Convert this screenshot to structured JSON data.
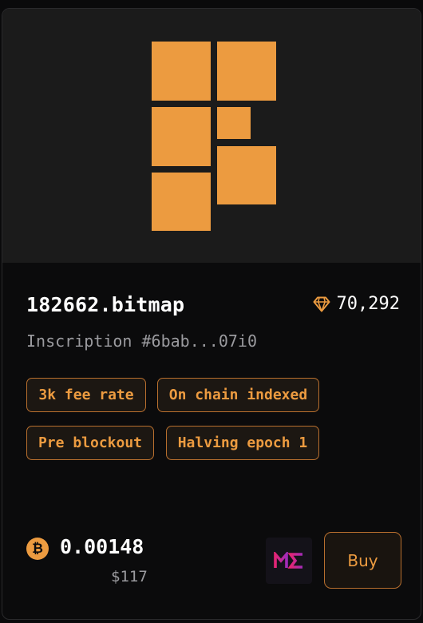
{
  "item": {
    "title": "182662.bitmap",
    "subtitle": "Inscription #6bab...07i0",
    "rarity_score": "70,292",
    "rarity_icon": "diamond-icon"
  },
  "tags": [
    "3k fee rate",
    "On chain indexed",
    "Pre blockout",
    "Halving epoch 1"
  ],
  "price": {
    "currency_icon": "bitcoin-icon",
    "btc": "0.00148",
    "usd": "$117"
  },
  "marketplace": {
    "logo": "magic-eden-logo"
  },
  "buy_label": "Buy",
  "colors": {
    "accent": "#ec9b40",
    "background": "#0b0b0c",
    "art_background": "#1b1b1b",
    "tag_border": "#b86f2e",
    "muted_text": "#9b9b9f",
    "magic_eden_gradient": [
      "#e42575",
      "#a02bb8"
    ]
  }
}
